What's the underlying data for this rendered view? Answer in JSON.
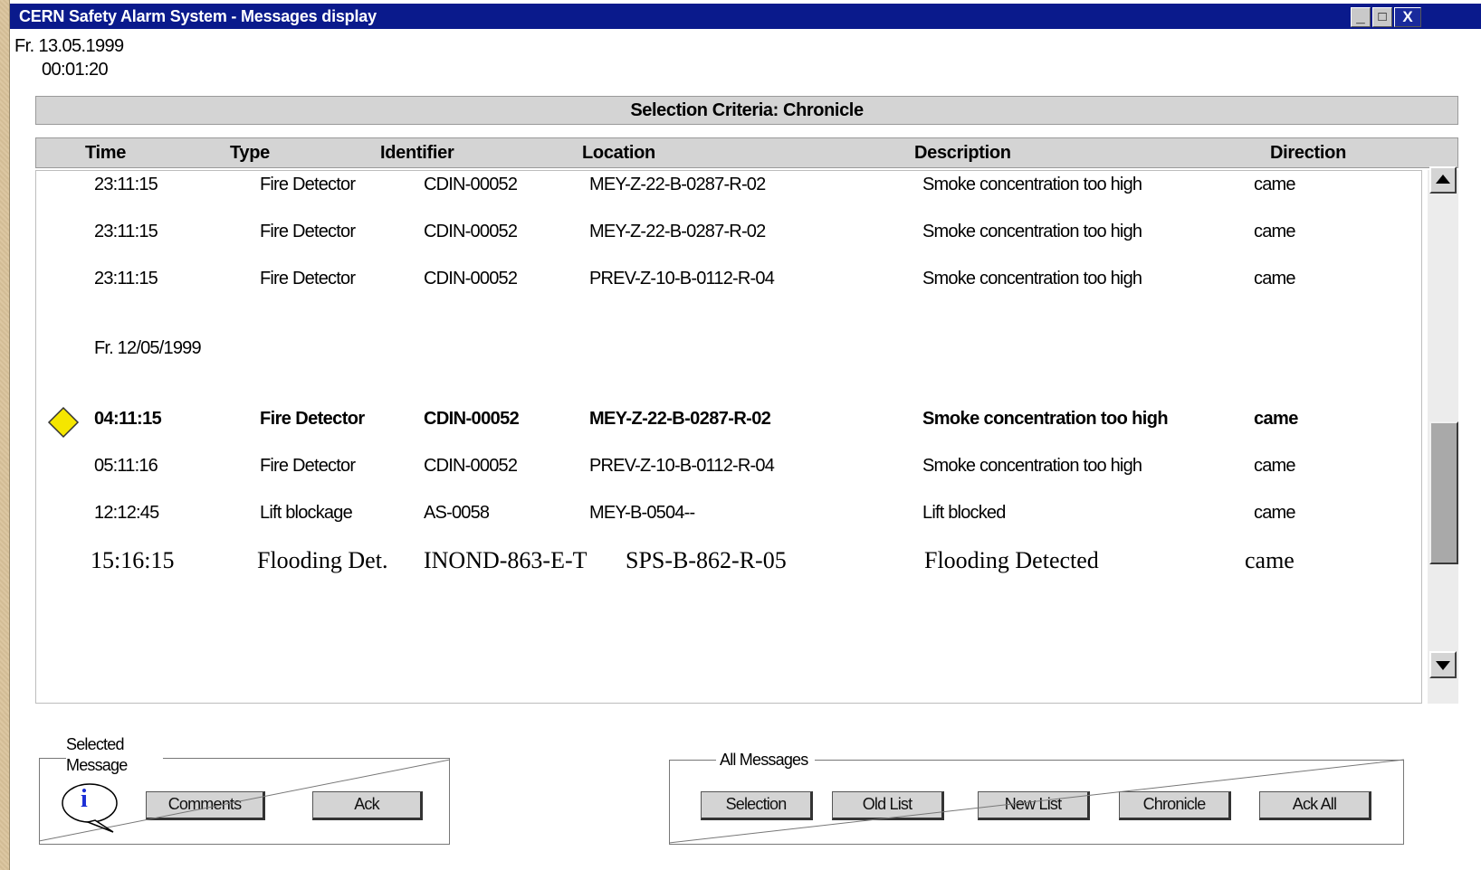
{
  "window": {
    "title": "CERN Safety Alarm System - Messages display",
    "controls": {
      "minimize": "_",
      "maximize": "□",
      "close": "X"
    }
  },
  "datetime": {
    "date": "Fr. 13.05.1999",
    "time": "00:01:20"
  },
  "selection_criteria": "Selection Criteria: Chronicle",
  "columns": {
    "time": "Time",
    "type": "Type",
    "identifier": "Identifier",
    "location": "Location",
    "description": "Description",
    "direction": "Direction"
  },
  "rows": [
    {
      "time": "23:11:15",
      "type": "Fire Detector",
      "identifier": "CDIN-00052",
      "location": "MEY-Z-22-B-0287-R-02",
      "description": "Smoke concentration too high",
      "direction": "came"
    },
    {
      "time": "23:11:15",
      "type": "Fire Detector",
      "identifier": "CDIN-00052",
      "location": "MEY-Z-22-B-0287-R-02",
      "description": "Smoke concentration too high",
      "direction": "came"
    },
    {
      "time": "23:11:15",
      "type": "Fire Detector",
      "identifier": "CDIN-00052",
      "location": "PREV-Z-10-B-0112-R-04",
      "description": "Smoke concentration too high",
      "direction": "came"
    },
    {
      "date_separator": "Fr. 12/05/1999"
    },
    {
      "time": "04:11:15",
      "type": "Fire Detector",
      "identifier": "CDIN-00052",
      "location": "MEY-Z-22-B-0287-R-02",
      "description": "Smoke concentration too high",
      "direction": "came",
      "selected": true,
      "marker": "yellow-diamond"
    },
    {
      "time": "05:11:16",
      "type": "Fire Detector",
      "identifier": "CDIN-00052",
      "location": "PREV-Z-10-B-0112-R-04",
      "description": "Smoke concentration too high",
      "direction": "came"
    },
    {
      "time": "12:12:45",
      "type": "Lift blockage",
      "identifier": "AS-0058",
      "location": "MEY-B-0504--",
      "description": "Lift blocked",
      "direction": "came"
    },
    {
      "time": "15:16:15",
      "type": "Flooding Det.",
      "identifier": "INOND-863-E-T",
      "location": "SPS-B-862-R-05",
      "description": "Flooding Detected",
      "direction": "came"
    }
  ],
  "selected_message": {
    "label_line1": "Selected",
    "label_line2": "Message",
    "info_icon": "i",
    "comments": "Comments",
    "ack": "Ack"
  },
  "all_messages": {
    "label": "All Messages",
    "buttons": [
      "Selection",
      "Old List",
      "New List",
      "Chronicle",
      "Ack All"
    ]
  },
  "colors": {
    "titlebar": "#0a1a8c",
    "bar_gray": "#d4d4d4",
    "marker": "#f5e600"
  }
}
